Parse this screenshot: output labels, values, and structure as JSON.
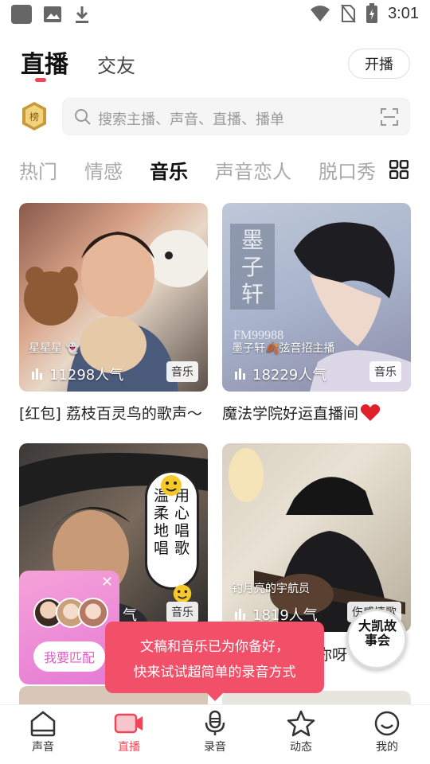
{
  "status_bar": {
    "time": "3:01"
  },
  "header": {
    "tabs": [
      {
        "label": "直播"
      },
      {
        "label": "交友"
      }
    ],
    "start_button": "开播"
  },
  "search": {
    "placeholder": "搜索主播、声音、直播、播单"
  },
  "categories": [
    "热门",
    "情感",
    "音乐",
    "声音恋人",
    "脱口秀"
  ],
  "cards": [
    {
      "host": "星星星 👻",
      "popularity": "11298人气",
      "tag": "音乐",
      "title": "[红包] 荔枝百灵鸟的歌声〜"
    },
    {
      "host": "墨子轩🍂弦音招主播",
      "popularity": "18229人气",
      "tag": "音乐",
      "title": "魔法学院好运直播间"
    },
    {
      "host": "",
      "popularity": "气",
      "tag": "音乐",
      "title": ""
    },
    {
      "host": "钓月亮的宇航员",
      "popularity": "1819人气",
      "tag": "伤感情歌",
      "title": "你呀"
    }
  ],
  "card2_art": {
    "vertical_text": "墨子轩",
    "fm": "FM99988"
  },
  "card3_art": {
    "lines": [
      "温柔地唱",
      "用心唱歌"
    ]
  },
  "match_popup": {
    "button": "我要匹配"
  },
  "recording_tip": {
    "line1": "文稿和音乐已为你备好，",
    "line2": "快来试试超简单的录音方式"
  },
  "float_avatar": {
    "text": "大凯故事会"
  },
  "bottom_nav": [
    {
      "label": "声音",
      "icon": "home-icon"
    },
    {
      "label": "直播",
      "icon": "video-camera-icon"
    },
    {
      "label": "录音",
      "icon": "microphone-icon"
    },
    {
      "label": "动态",
      "icon": "star-icon"
    },
    {
      "label": "我的",
      "icon": "profile-icon"
    }
  ],
  "colors": {
    "accent": "#f04556",
    "tip_bg": "#f25068",
    "match_bg": "#e57ad6"
  }
}
